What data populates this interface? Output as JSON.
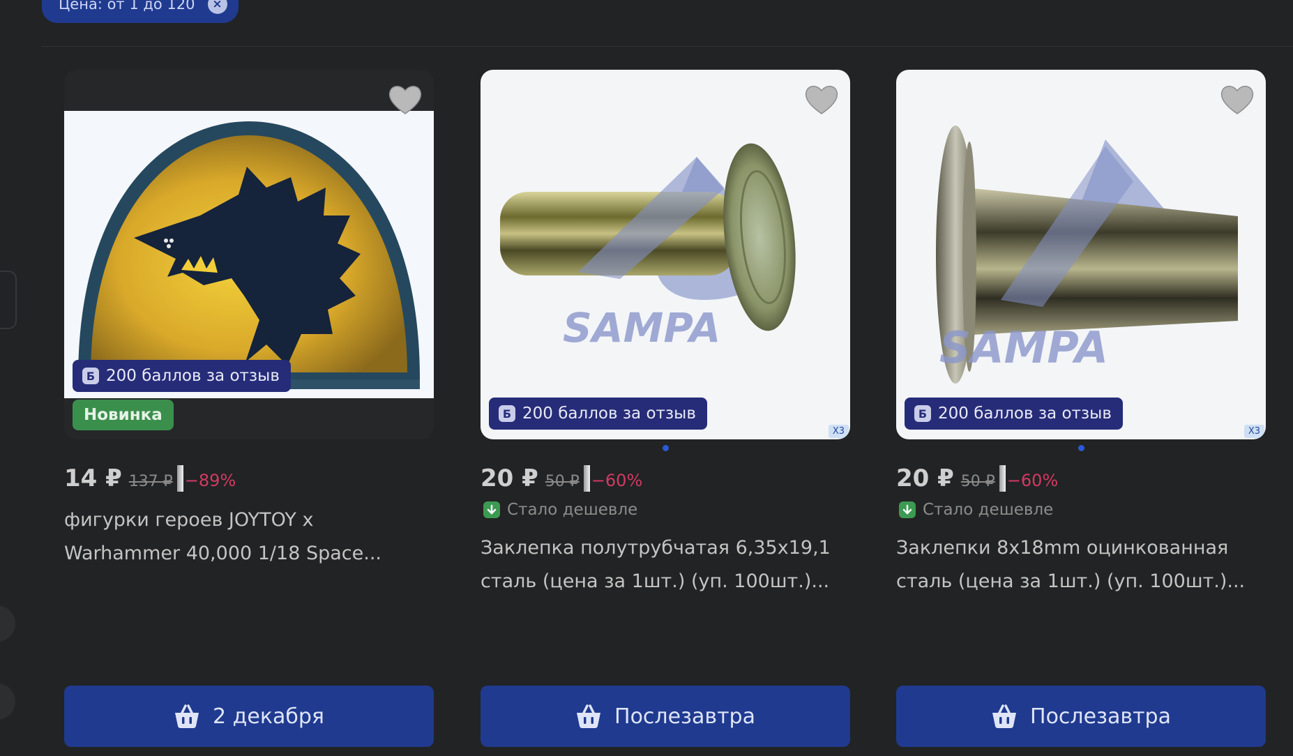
{
  "filter": {
    "label": "Цена: от 1 до 120",
    "close_symbol": "×"
  },
  "products": [
    {
      "image_icon": "warhammer-space-wolves-shoulder-icon",
      "points_icon": "Б",
      "points_label": "200 баллов за отзыв",
      "new_label": "Новинка",
      "price": "14 ₽",
      "old_price": "137 ₽",
      "discount": "−89%",
      "cheaper_label": "",
      "title": "фигурки героев JOYTOY x Warhammer 40,000 1/18 Space...",
      "button_label": "2 декабря"
    },
    {
      "image_icon": "rivet-sampa-icon",
      "image_watermark": "SAMPA",
      "points_icon": "Б",
      "points_label": "200 баллов за отзыв",
      "zoom_badge": "X3",
      "price": "20 ₽",
      "old_price": "50 ₽",
      "discount": "−60%",
      "cheaper_label": "Стало дешевле",
      "title": "Заклепка полутрубчатая 6,35x19,1 сталь (цена за 1шт.) (уп. 100шт.)...",
      "button_label": "Послезавтра"
    },
    {
      "image_icon": "rivet-sampa-icon",
      "image_watermark": "SAMPA",
      "points_icon": "Б",
      "points_label": "200 баллов за отзыв",
      "zoom_badge": "X3",
      "price": "20 ₽",
      "old_price": "50 ₽",
      "discount": "−60%",
      "cheaper_label": "Стало дешевле",
      "title": "Заклепки 8x18mm оцинкованная сталь (цена за 1шт.) (уп. 100шт.)...",
      "button_label": "Послезавтра"
    }
  ],
  "colors": {
    "background": "#222324",
    "accent": "#1f3a8f",
    "discount": "#d23a64",
    "new_badge": "#3b8f4c",
    "points_badge": "#262c78"
  }
}
